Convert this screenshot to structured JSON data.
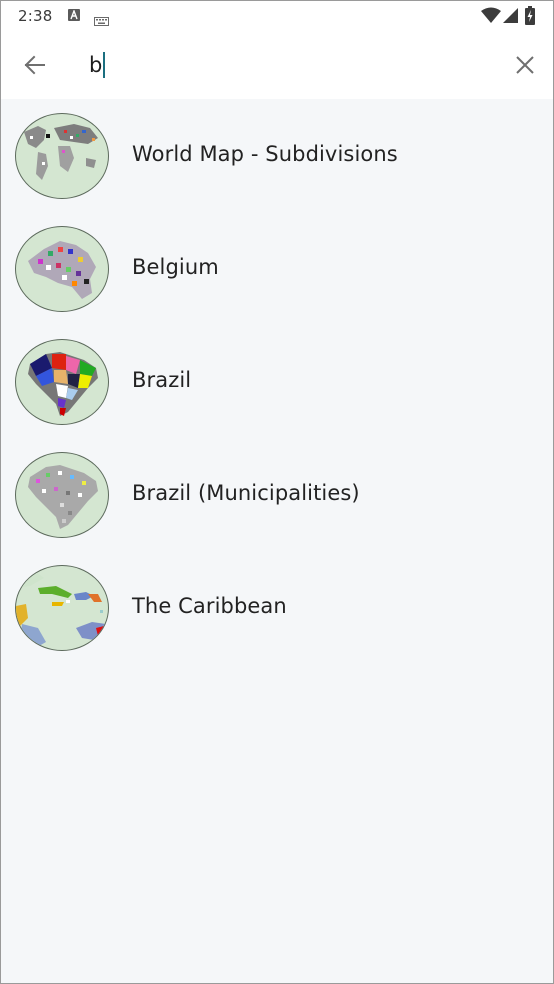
{
  "status_bar": {
    "time": "2:38",
    "icons": [
      "text-a-icon",
      "keyboard-icon",
      "wifi-icon",
      "signal-icon",
      "battery-charging-icon"
    ]
  },
  "search": {
    "value": "b",
    "placeholder": ""
  },
  "results": [
    {
      "label": "World Map - Subdivisions",
      "icon": "world-map-thumbnail"
    },
    {
      "label": "Belgium",
      "icon": "belgium-map-thumbnail"
    },
    {
      "label": "Brazil",
      "icon": "brazil-map-thumbnail"
    },
    {
      "label": "Brazil (Municipalities)",
      "icon": "brazil-municipalities-map-thumbnail"
    },
    {
      "label": "The Caribbean",
      "icon": "caribbean-map-thumbnail"
    }
  ],
  "colors": {
    "background": "#f5f7f9",
    "header": "#ffffff",
    "cursor": "#1b6f80",
    "thumbnail_sea": "#d4e6d1",
    "text": "#222222"
  }
}
